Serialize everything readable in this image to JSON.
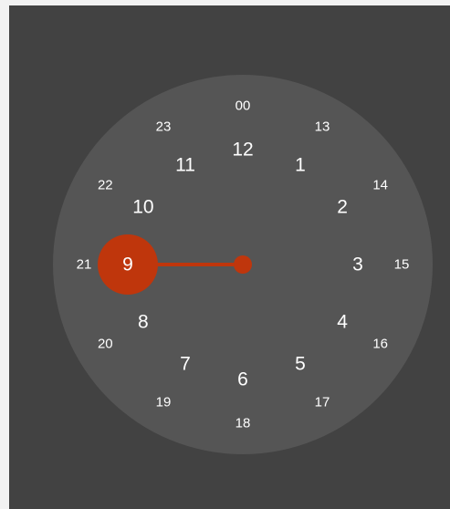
{
  "clock": {
    "selected_hour": 9,
    "accent_color": "#bf360c",
    "inner_hours": [
      "12",
      "1",
      "2",
      "3",
      "4",
      "5",
      "6",
      "7",
      "8",
      "9",
      "10",
      "11"
    ],
    "outer_hours": [
      "00",
      "13",
      "14",
      "15",
      "16",
      "17",
      "18",
      "19",
      "20",
      "21",
      "22",
      "23"
    ]
  }
}
